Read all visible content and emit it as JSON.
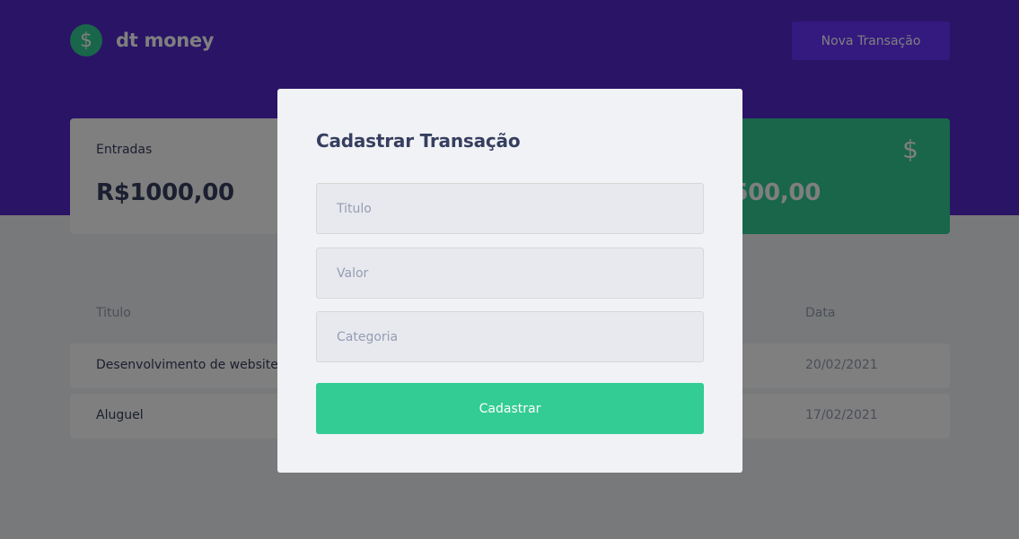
{
  "header": {
    "logo_symbol": "$",
    "logo_text": "dt money",
    "new_transaction_label": "Nova Transação"
  },
  "summary": {
    "income": {
      "label": "Entradas",
      "value": "R$1000,00"
    },
    "total": {
      "value_visible": "500,00",
      "icon": "$"
    }
  },
  "table": {
    "headers": {
      "title": "Titulo",
      "date": "Data"
    },
    "rows": [
      {
        "title": "Desenvolvimento de website",
        "date": "20/02/2021"
      },
      {
        "title": "Aluguel",
        "date": "17/02/2021"
      }
    ]
  },
  "modal": {
    "title": "Cadastrar Transação",
    "fields": {
      "title_placeholder": "Titulo",
      "value_placeholder": "Valor",
      "category_placeholder": "Categoria"
    },
    "submit_label": "Cadastrar"
  },
  "colors": {
    "header_bg": "#5429cc",
    "button_bg": "#6933ff",
    "green": "#33cc95",
    "text_title": "#363f5f",
    "text_body": "#969cb3"
  }
}
